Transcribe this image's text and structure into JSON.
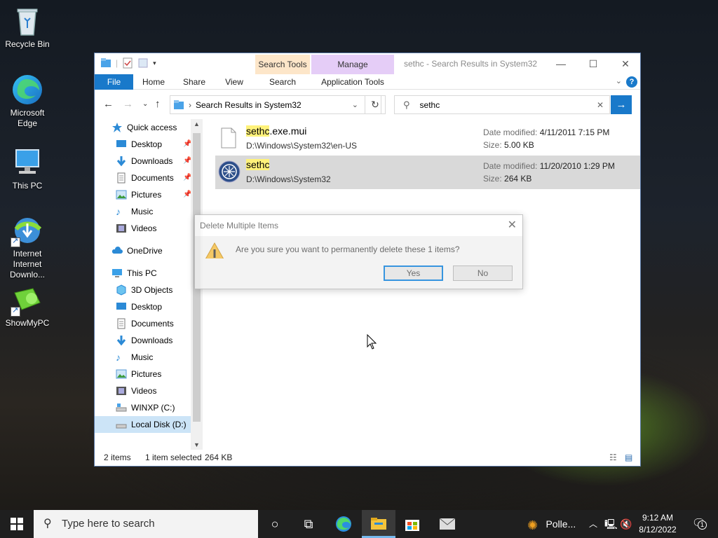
{
  "desktop": {
    "icons": [
      {
        "label": "Recycle Bin"
      },
      {
        "label": "Microsoft Edge"
      },
      {
        "label": "This PC"
      },
      {
        "label": "Internet Downlo..."
      },
      {
        "label": "ShowMyPC"
      }
    ]
  },
  "window": {
    "title": "sethc - Search Results in System32",
    "contextual_tabs": {
      "search_tools": "Search Tools",
      "manage": "Manage"
    },
    "tabs": {
      "file": "File",
      "home": "Home",
      "share": "Share",
      "view": "View",
      "search": "Search",
      "application_tools": "Application Tools"
    },
    "address": "Search Results in System32",
    "search_value": "sethc",
    "nav": {
      "quick_access": "Quick access",
      "qa_items": [
        "Desktop",
        "Downloads",
        "Documents",
        "Pictures",
        "Music",
        "Videos"
      ],
      "onedrive": "OneDrive",
      "this_pc": "This PC",
      "pc_items": [
        "3D Objects",
        "Desktop",
        "Documents",
        "Downloads",
        "Music",
        "Pictures",
        "Videos",
        "WINXP (C:)",
        "Local Disk (D:)"
      ]
    },
    "files": [
      {
        "name_highlight": "sethc",
        "name_rest": ".exe.mui",
        "path": "D:\\Windows\\System32\\en-US",
        "date_label": "Date modified:",
        "date": "4/11/2011 7:15 PM",
        "size_label": "Size:",
        "size": "5.00 KB"
      },
      {
        "name_highlight": "sethc",
        "name_rest": "",
        "path": "D:\\Windows\\System32",
        "date_label": "Date modified:",
        "date": "11/20/2010 1:29 PM",
        "size_label": "Size:",
        "size": "264 KB"
      }
    ],
    "status": {
      "count": "2 items",
      "selected": "1 item selected",
      "size": "264 KB"
    }
  },
  "dialog": {
    "title": "Delete Multiple Items",
    "message": "Are you sure you want to permanently delete these 1 items?",
    "yes": "Yes",
    "no": "No"
  },
  "taskbar": {
    "search_placeholder": "Type here to search",
    "weather": "Polle...",
    "time": "9:12 AM",
    "date": "8/12/2022",
    "notification_count": "1"
  }
}
